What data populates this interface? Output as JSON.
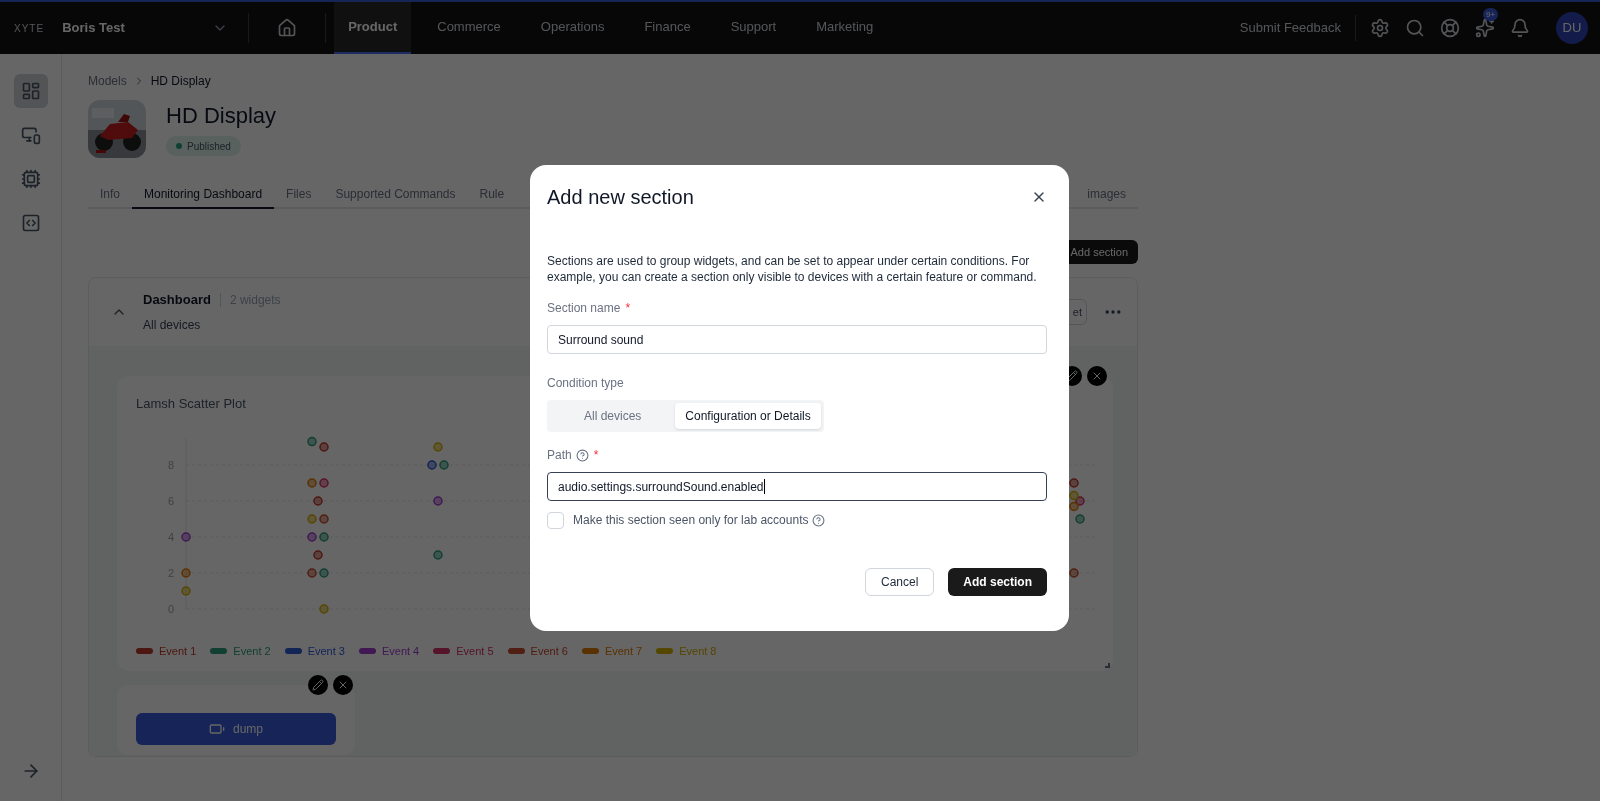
{
  "topbar": {
    "logo": "XYTE",
    "workspace": "Boris Test",
    "nav": [
      {
        "label": "Product",
        "selected": true
      },
      {
        "label": "Commerce",
        "selected": false
      },
      {
        "label": "Operations",
        "selected": false
      },
      {
        "label": "Finance",
        "selected": false
      },
      {
        "label": "Support",
        "selected": false
      },
      {
        "label": "Marketing",
        "selected": false
      }
    ],
    "feedback": "Submit Feedback",
    "notification_badge": "9+",
    "avatar": "DU"
  },
  "rail": {
    "items": [
      {
        "selected": true
      },
      {
        "selected": false
      },
      {
        "selected": false
      },
      {
        "selected": false
      }
    ]
  },
  "breadcrumb": [
    "Models",
    "HD Display"
  ],
  "model": {
    "title": "HD Display",
    "status": "Published"
  },
  "tabs": [
    {
      "label": "Info",
      "selected": false
    },
    {
      "label": "Monitoring Dashboard",
      "selected": true
    },
    {
      "label": "Files",
      "selected": false
    },
    {
      "label": "Supported Commands",
      "selected": false
    },
    {
      "label": "Rule",
      "selected": false
    }
  ],
  "tab_right": "images",
  "add_section_button": "Add section",
  "section": {
    "title": "Dashboard",
    "count": "2 widgets",
    "condition": "All devices",
    "expanded": true,
    "button_fragment": "et"
  },
  "scatter_widget": {
    "title": "Lamsh Scatter Plot",
    "y_axis_labels": [
      "8",
      "6",
      "4",
      "2",
      "0"
    ],
    "legend": [
      {
        "name": "Event 1",
        "color": "#4d1711"
      },
      {
        "name": "Event 2",
        "color": "#113f32"
      },
      {
        "name": "Event 3",
        "color": "#132456"
      },
      {
        "name": "Event 4",
        "color": "#411853"
      },
      {
        "name": "Event 5",
        "color": "#56142b"
      },
      {
        "name": "Event 6",
        "color": "#501e12"
      },
      {
        "name": "Event 7",
        "color": "#5a3100"
      },
      {
        "name": "Event 8",
        "color": "#554600"
      }
    ]
  },
  "command_widget": {
    "button": "dump"
  },
  "modal": {
    "title": "Add new section",
    "description": "Sections are used to group widgets, and can be set to appear under certain conditions. For example, you can create a section only visible to devices with a certain feature or command.",
    "section_name": {
      "label": "Section name",
      "required_mark": "*",
      "value": "Surround sound"
    },
    "condition_type": {
      "label": "Condition type",
      "options": [
        {
          "label": "All devices",
          "selected": false
        },
        {
          "label": "Configuration or Details",
          "selected": true
        }
      ]
    },
    "path": {
      "label": "Path",
      "required_mark": "*",
      "value": "audio.settings.surroundSound.enabled"
    },
    "lab_only": {
      "label": "Make this section seen only for lab accounts",
      "checked": false
    },
    "buttons": [
      {
        "label": "Cancel",
        "kind": "secondary"
      },
      {
        "label": "Add section",
        "kind": "primary"
      }
    ]
  }
}
